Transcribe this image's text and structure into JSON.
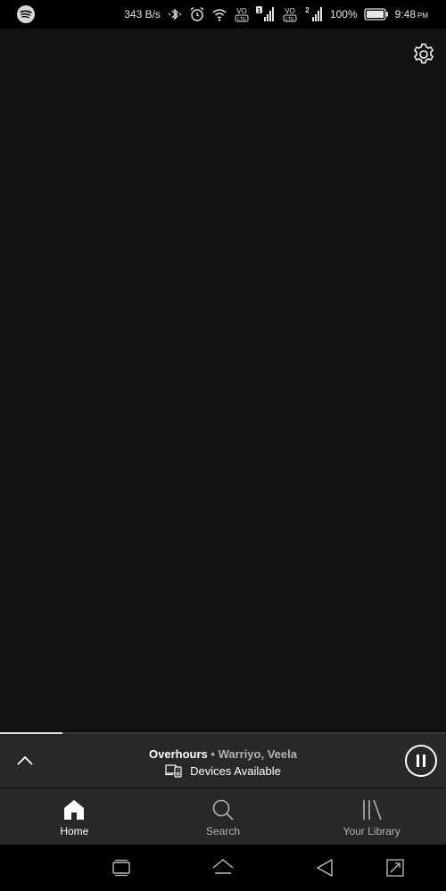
{
  "status_bar": {
    "net_speed": "343 B/s",
    "battery_percent": "100%",
    "time": "9:48",
    "time_suffix": "PM",
    "sim1_badge": "1",
    "sim2_badge": "2",
    "volte_label_top": "VO",
    "volte_label_bottom": "LTE"
  },
  "now_playing": {
    "title": "Overhours",
    "separator": " • ",
    "artists": "Warriyo, Veela",
    "device_status": "Devices Available",
    "progress_fraction": 0.14
  },
  "bottom_nav": {
    "items": [
      {
        "label": "Home",
        "icon": "home-icon",
        "active": true
      },
      {
        "label": "Search",
        "icon": "search-icon",
        "active": false
      },
      {
        "label": "Your Library",
        "icon": "library-icon",
        "active": false
      }
    ]
  },
  "colors": {
    "background": "#121212",
    "player_bar": "#282828",
    "active_text": "#ffffff",
    "inactive_text": "#b3b3b3"
  }
}
